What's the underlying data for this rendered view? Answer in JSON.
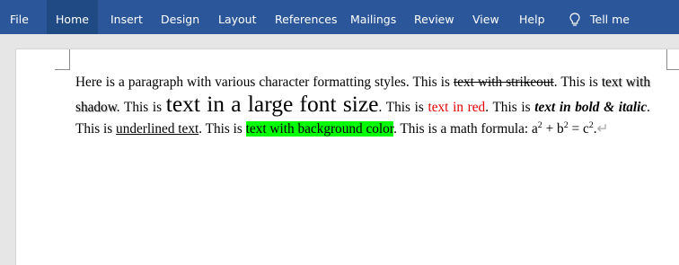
{
  "ribbon": {
    "tabs": [
      "File",
      "Home",
      "Insert",
      "Design",
      "Layout",
      "References",
      "Mailings",
      "Review",
      "View",
      "Help"
    ],
    "active_tab": "Home",
    "tell_me": "Tell me",
    "colors": {
      "ribbon": "#2b579a",
      "active_tab": "#1f4a84"
    }
  },
  "document": {
    "s1": "Here is a paragraph with various character formatting styles. This is ",
    "strike": "text with strikeout",
    "s2": ". This is ",
    "shadow": "text with shadow",
    "s3": ". This is ",
    "large": "text in a large font size",
    "s4": ". This is ",
    "red": "text in red",
    "s5": ". This is ",
    "bold_italic": "text in bold & italic",
    "s6": ". This is ",
    "underline": "underlined text",
    "s7": ". This is ",
    "highlight": "text with background color",
    "s8": ". This is a math formula: a",
    "sup1": "2",
    "s9": " + b",
    "sup2": "2",
    "s10": " = c",
    "sup3": "2",
    "s11": ".",
    "pilcrow": "↵",
    "colors": {
      "red_text": "#e00000",
      "highlight": "#00ff00"
    }
  }
}
